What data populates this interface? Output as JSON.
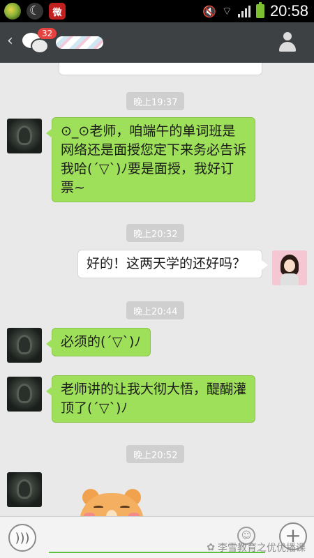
{
  "status_bar": {
    "time": "20:58",
    "icons": [
      "app-green-icon",
      "moon-icon",
      "weibo-icon",
      "mute-icon",
      "wifi-icon",
      "signal-icon",
      "battery-icon"
    ]
  },
  "header": {
    "unread_count": "32"
  },
  "messages": [
    {
      "timestamp": "晚上19:37"
    },
    {
      "from": "friend",
      "text": "⊙_⊙老师，咱端午的单词班是网络还是面授您定下来务必告诉我哈(´▽`)ﾉ要是面授，我好订票~"
    },
    {
      "timestamp": "晚上20:32"
    },
    {
      "from": "me",
      "text": "好的！这两天学的还好吗？"
    },
    {
      "timestamp": "晚上20:44"
    },
    {
      "from": "friend",
      "text": "必须的(´▽`)ﾉ"
    },
    {
      "from": "friend",
      "text": "老师讲的让我大彻大悟，醍醐灌顶了(´▽`)ﾉ"
    },
    {
      "timestamp": "晚上20:52"
    },
    {
      "from": "friend",
      "sticker": "bear-sticker"
    }
  ],
  "input_bar": {
    "placeholder": "",
    "watermark": "李雪教育之优优播课"
  },
  "colors": {
    "incoming_bubble": "#9fe05a",
    "outgoing_bubble": "#ffffff",
    "header_bg": "#3d4143",
    "chat_bg": "#e9e9e9"
  }
}
